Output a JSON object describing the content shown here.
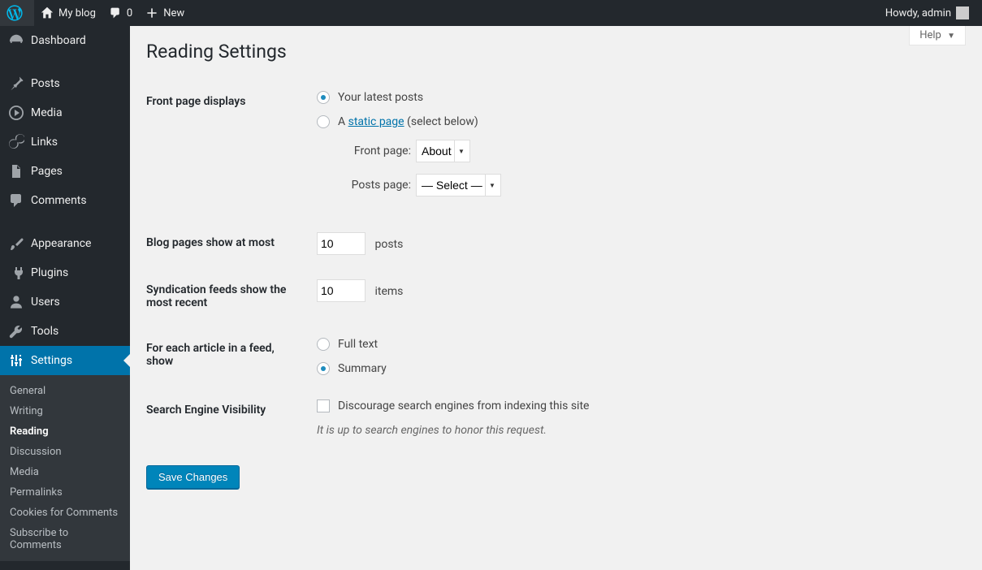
{
  "toolbar": {
    "site_name": "My blog",
    "comments_count": "0",
    "new_label": "New",
    "howdy": "Howdy, admin"
  },
  "help": {
    "label": "Help"
  },
  "sidebar": {
    "items": [
      {
        "id": "dashboard",
        "label": "Dashboard"
      },
      {
        "id": "posts",
        "label": "Posts"
      },
      {
        "id": "media",
        "label": "Media"
      },
      {
        "id": "links",
        "label": "Links"
      },
      {
        "id": "pages",
        "label": "Pages"
      },
      {
        "id": "comments",
        "label": "Comments"
      },
      {
        "id": "appearance",
        "label": "Appearance"
      },
      {
        "id": "plugins",
        "label": "Plugins"
      },
      {
        "id": "users",
        "label": "Users"
      },
      {
        "id": "tools",
        "label": "Tools"
      },
      {
        "id": "settings",
        "label": "Settings"
      }
    ],
    "settings_sub": [
      {
        "id": "general",
        "label": "General"
      },
      {
        "id": "writing",
        "label": "Writing"
      },
      {
        "id": "reading",
        "label": "Reading"
      },
      {
        "id": "discussion",
        "label": "Discussion"
      },
      {
        "id": "media",
        "label": "Media"
      },
      {
        "id": "permalinks",
        "label": "Permalinks"
      },
      {
        "id": "cookies-for-comments",
        "label": "Cookies for Comments"
      },
      {
        "id": "subscribe-to-comments",
        "label": "Subscribe to Comments"
      }
    ]
  },
  "page": {
    "title": "Reading Settings",
    "front_page_displays_label": "Front page displays",
    "option_latest_posts": "Your latest posts",
    "option_static_prefix": "A ",
    "option_static_link": "static page",
    "option_static_suffix": " (select below)",
    "front_page_label": "Front page:",
    "front_page_value": "About",
    "posts_page_label": "Posts page:",
    "posts_page_value": "— Select —",
    "blog_pages_label": "Blog pages show at most",
    "blog_pages_value": "10",
    "blog_pages_suffix": "posts",
    "feeds_label": "Syndication feeds show the most recent",
    "feeds_value": "10",
    "feeds_suffix": "items",
    "article_feed_label": "For each article in a feed, show",
    "article_feed_full": "Full text",
    "article_feed_summary": "Summary",
    "sev_label": "Search Engine Visibility",
    "sev_checkbox_label": "Discourage search engines from indexing this site",
    "sev_note": "It is up to search engines to honor this request.",
    "save_button": "Save Changes"
  }
}
